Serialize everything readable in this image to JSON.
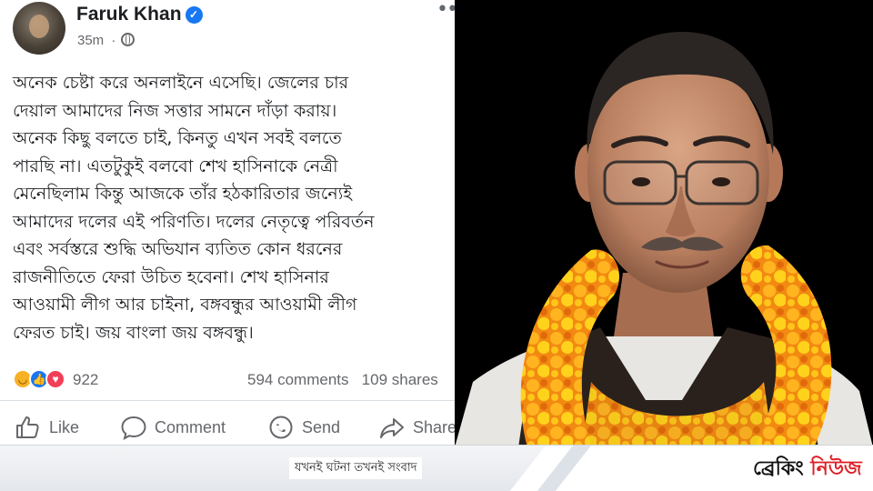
{
  "post": {
    "author": "Faruk Khan",
    "time": "35m",
    "icons": {
      "verified": "verified-badge-icon",
      "audience": "globe-icon",
      "menu": "more-options-icon"
    },
    "lines": [
      "অনেক চেষ্টা করে অনলাইনে এসেছি। জেলের চার",
      "দেয়াল আমাদের নিজ সত্তার সামনে দাঁড়া করায়।",
      "অনেক কিছু বলতে চাই, কিনতু এখন সবই বলতে",
      "পারছি না। এতটুকুই বলবো শেখ হাসিনাকে নেত্রী",
      "মেনেছিলাম কিন্তু আজকে তাঁর হঠকারিতার জন্যেই",
      "আমাদের দলের এই পরিণতি। দলের নেতৃত্বে পরিবর্তন",
      "এবং সর্বস্তরে শুদ্ধি অভিযান ব্যতিত কোন ধরনের",
      "রাজনীতিতে ফেরা উচিত হবেনা। শেখ হাসিনার",
      "আওয়ামী লীগ আর চাইনা, বঙ্গবন্ধুর আওয়ামী লীগ",
      "ফেরত চাই। জয় বাংলা জয় বঙ্গবন্ধু।"
    ],
    "reactions": {
      "icons": [
        "haha-icon",
        "like-icon",
        "love-icon"
      ],
      "count": "922"
    },
    "stats": {
      "comments": "594 comments",
      "shares": "109 shares"
    },
    "actions": {
      "like": "Like",
      "comment": "Comment",
      "send": "Send",
      "share": "Share"
    }
  },
  "banner": {
    "tagline": "যখনই ঘটনা তখনই সংবাদ",
    "brand_part1": "ব্রেকিং",
    "brand_part2": "নিউজ"
  },
  "colors": {
    "facebook_blue": "#1877f2",
    "text_primary": "#1c1e21",
    "text_secondary": "#65676b",
    "brand_red": "#e01f26",
    "garland_orange": "#f28a12",
    "garland_yellow": "#ffd21c"
  }
}
